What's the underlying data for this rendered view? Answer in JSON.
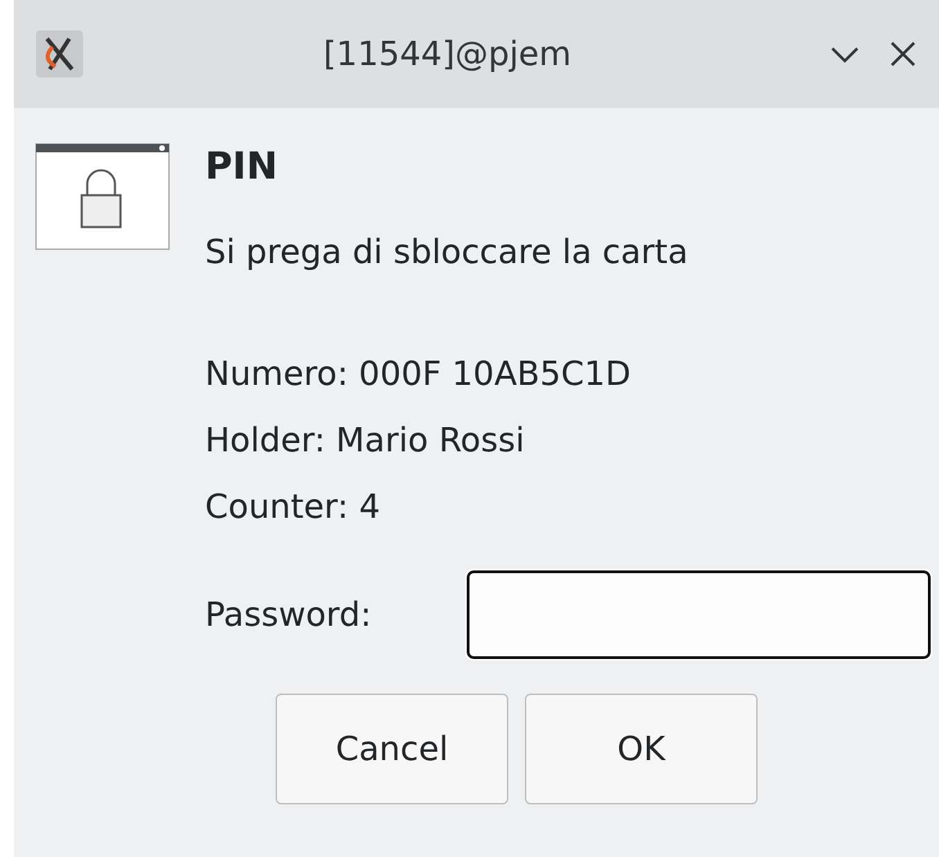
{
  "window": {
    "title": "[11544]@pjem"
  },
  "heading": "PIN",
  "message": "Si prega di sbloccare la carta",
  "details": [
    "Numero: 000F 10AB5C1D",
    "Holder: Mario Rossi",
    "Counter: 4"
  ],
  "password": {
    "label": "Password:"
  },
  "buttons": [
    "Cancel",
    "OK"
  ]
}
